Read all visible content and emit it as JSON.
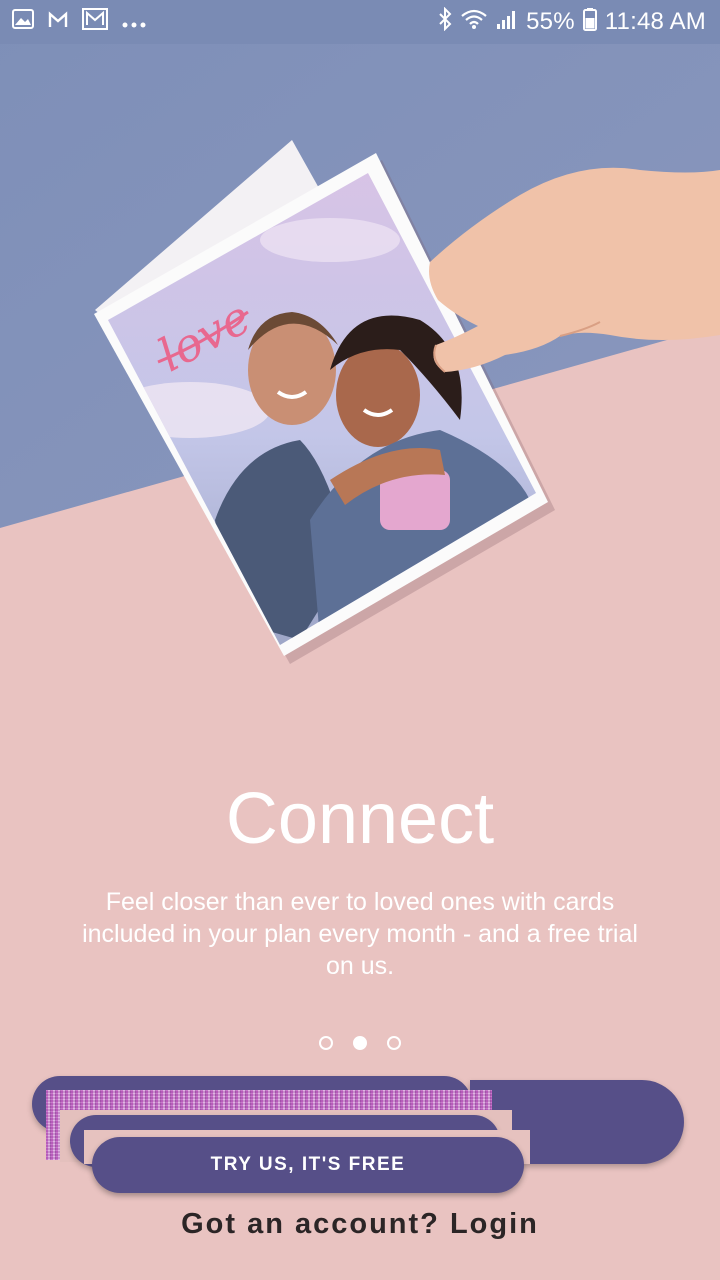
{
  "status_bar": {
    "battery": "55%",
    "time": "11:48 AM",
    "left_icons": [
      "image-icon",
      "gmail-icon",
      "mail-icon",
      "more-dots-icon"
    ],
    "right_icons": [
      "bluetooth-icon",
      "wifi-icon",
      "signal-icon",
      "battery-icon"
    ]
  },
  "hero": {
    "card_lettering": "love"
  },
  "onboarding": {
    "title": "Connect",
    "description": "Feel closer than ever to loved ones with cards included in your plan every month - and a free trial on us.",
    "page_indicator": {
      "total": 3,
      "active_index": 1
    }
  },
  "actions": {
    "primary_label": "TRY US, IT'S FREE",
    "login_label": "Got an account? Login"
  },
  "colors": {
    "wall": "#7c8fb7",
    "table": "#e9c3c1",
    "button": "#564f88",
    "login_text": "#2b2526"
  }
}
